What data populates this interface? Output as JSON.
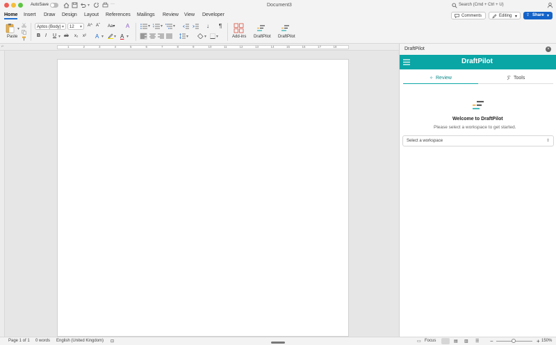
{
  "titlebar": {
    "autosave_label": "AutoSave",
    "doc_title": "Document3",
    "search_placeholder": "Search (Cmd + Ctrl + U)"
  },
  "tabs": [
    "Home",
    "Insert",
    "Draw",
    "Design",
    "Layout",
    "References",
    "Mailings",
    "Review",
    "View",
    "Developer"
  ],
  "top_actions": {
    "comments": "Comments",
    "editing": "Editing",
    "share": "Share"
  },
  "toolbar": {
    "paste": "Paste",
    "font_name": "Aptos (Body)",
    "font_size": "12",
    "addins": "Add-ins",
    "draftpilot1": "DraftPilot",
    "draftpilot2": "DraftPilot"
  },
  "ruler_numbers": [
    "1",
    "2",
    "3",
    "4",
    "5",
    "6",
    "7",
    "8",
    "9",
    "10",
    "11",
    "12",
    "13",
    "14",
    "15",
    "16",
    "17",
    "18"
  ],
  "sidebar": {
    "header": "DraftPilot",
    "brand": "DraftPilot",
    "tab_review": "Review",
    "tab_tools": "Tools",
    "welcome_title": "Welcome to DraftPilot",
    "welcome_sub": "Please select a workspace to get started.",
    "select_placeholder": "Select a workspace"
  },
  "status": {
    "page": "Page 1 of 1",
    "words": "0 words",
    "language": "English (United Kingdom)",
    "focus": "Focus",
    "zoom": "150%"
  },
  "colors": {
    "accent": "#1f6fd1",
    "teal": "#0aa5a5",
    "share": "#1463c8"
  }
}
